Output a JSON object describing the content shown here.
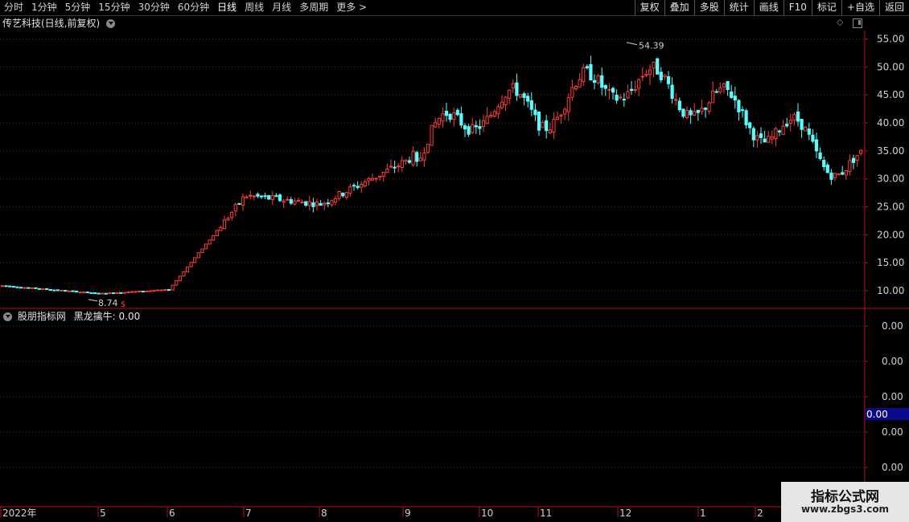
{
  "toolbar": {
    "periods": [
      "分时",
      "1分钟",
      "5分钟",
      "15分钟",
      "30分钟",
      "60分钟",
      "日线",
      "周线",
      "月线",
      "多周期",
      "更多 >"
    ],
    "active_index": 6,
    "buttons": [
      "复权",
      "叠加",
      "多股",
      "统计",
      "画线",
      "F10",
      "标记",
      "+自选",
      "返回"
    ]
  },
  "main_title": "传艺科技(日线,前复权)",
  "price_axis": {
    "labels": [
      "55.00",
      "50.00",
      "45.00",
      "40.00",
      "35.00",
      "30.00",
      "25.00",
      "20.00",
      "15.00",
      "10.00"
    ],
    "values": [
      55,
      50,
      45,
      40,
      35,
      30,
      25,
      20,
      15,
      10
    ]
  },
  "annotations": {
    "high_label": "54.39",
    "low_label": "8.74",
    "low_marker": "$"
  },
  "indicator": {
    "name": "股朋指标网",
    "series_text": "黑龙擒牛: 0.00",
    "axis_labels": [
      "0.00",
      "0.00",
      "0.00",
      "0.00",
      "0.00"
    ],
    "current_value": "0.00"
  },
  "time_axis": {
    "labels": [
      "2022年",
      "5",
      "6",
      "7",
      "8",
      "9",
      "10",
      "11",
      "12",
      "1",
      "2"
    ]
  },
  "watermark": {
    "title": "指标公式网",
    "url": "www.zbgs3.com"
  },
  "colors": {
    "up": "#ff3b3b",
    "down": "#54ffff",
    "grid": "#7a1515",
    "axis": "#c01010",
    "highlight": "#0a0a8a"
  },
  "chart_data": {
    "type": "candlestick",
    "title": "传艺科技(日线,前复权)",
    "ylim": [
      7,
      56.5
    ],
    "x_labels": [
      "2022年",
      "5",
      "6",
      "7",
      "8",
      "9",
      "10",
      "11",
      "12",
      "1",
      "2"
    ],
    "high_point": 54.39,
    "low_point": 8.74,
    "series": [
      {
        "x": "2022年",
        "close": 10.9
      },
      {
        "x": "5",
        "close": 9.5
      },
      {
        "x": "6",
        "close": 10.2
      },
      {
        "x": "7",
        "close": 27.0
      },
      {
        "x": "8",
        "close": 25.5
      },
      {
        "x": "9",
        "close": 33.0
      },
      {
        "x": "10",
        "close": 43.0
      },
      {
        "x": "11",
        "close": 42.0
      },
      {
        "x": "12",
        "close": 48.0
      },
      {
        "x": "1",
        "close": 44.0
      },
      {
        "x": "2",
        "close": 40.5
      }
    ]
  }
}
